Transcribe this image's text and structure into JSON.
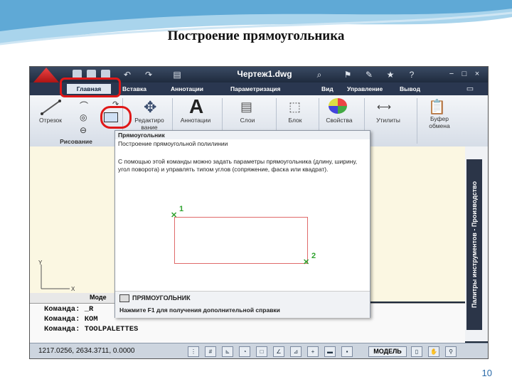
{
  "slide": {
    "title": "Построение прямоугольника",
    "page_number": "10"
  },
  "window": {
    "title": "Чертеж1.dwg"
  },
  "tabs": [
    "Главная",
    "Вставка",
    "Аннотации",
    "Параметризация",
    "Вид",
    "Управление",
    "Вывод"
  ],
  "ribbon": {
    "tools": [
      "Отрезок",
      "Редактиро вание",
      "Аннотации",
      "Слои",
      "Блок",
      "Свойства",
      "Утилиты",
      "Буфер обмена"
    ],
    "panel_draw": "Рисование"
  },
  "tooltip": {
    "name": "Прямоугольник",
    "subtitle": "Построение прямоугольной полилинии",
    "description": "С помощью этой команды можно задать параметры прямоугольника (длину, ширину, угол поворота) и управлять типом углов (сопряжение, фаска или квадрат).",
    "corner1": "1",
    "corner2": "2",
    "command": "ПРЯМОУГОЛЬНИК",
    "help": "Нажмите F1 для получения дополнительной справки"
  },
  "command_line": [
    "Команда:  _R",
    "Команда:  КОМ",
    "Команда:  TOOLPALETTES"
  ],
  "workspace": {
    "model_tab": "Моде"
  },
  "palette": {
    "title": "Палитры инструментов - Производство"
  },
  "statusbar": {
    "coords": "1217.0256, 2634.3711, 0.0000",
    "model": "МОДЕЛЬ"
  },
  "colors": {
    "highlight": "#e01818",
    "ribbon_dark": "#2a3750"
  }
}
